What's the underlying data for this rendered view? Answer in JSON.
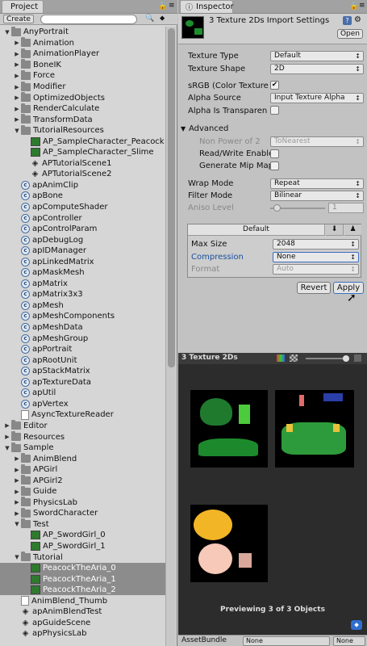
{
  "project": {
    "tab": "Project",
    "create_label": "Create",
    "tree": [
      {
        "label": "AnyPortrait",
        "depth": 0,
        "type": "folder",
        "open": true
      },
      {
        "label": "Animation",
        "depth": 1,
        "type": "folder",
        "arrow": true
      },
      {
        "label": "AnimationPlayer",
        "depth": 1,
        "type": "folder",
        "arrow": true
      },
      {
        "label": "BoneIK",
        "depth": 1,
        "type": "folder",
        "arrow": true
      },
      {
        "label": "Force",
        "depth": 1,
        "type": "folder",
        "arrow": true
      },
      {
        "label": "Modifier",
        "depth": 1,
        "type": "folder",
        "arrow": true
      },
      {
        "label": "OptimizedObjects",
        "depth": 1,
        "type": "folder",
        "arrow": true
      },
      {
        "label": "RenderCalculate",
        "depth": 1,
        "type": "folder",
        "arrow": true
      },
      {
        "label": "TransformData",
        "depth": 1,
        "type": "folder",
        "arrow": true
      },
      {
        "label": "TutorialResources",
        "depth": 1,
        "type": "folder",
        "open": true
      },
      {
        "label": "AP_SampleCharacter_Peacock",
        "depth": 2,
        "type": "img"
      },
      {
        "label": "AP_SampleCharacter_Slime",
        "depth": 2,
        "type": "img"
      },
      {
        "label": "APTutorialScene1",
        "depth": 2,
        "type": "unity"
      },
      {
        "label": "APTutorialScene2",
        "depth": 2,
        "type": "unity"
      },
      {
        "label": "apAnimClip",
        "depth": 1,
        "type": "cs"
      },
      {
        "label": "apBone",
        "depth": 1,
        "type": "cs"
      },
      {
        "label": "apComputeShader",
        "depth": 1,
        "type": "cs"
      },
      {
        "label": "apController",
        "depth": 1,
        "type": "cs"
      },
      {
        "label": "apControlParam",
        "depth": 1,
        "type": "cs"
      },
      {
        "label": "apDebugLog",
        "depth": 1,
        "type": "cs"
      },
      {
        "label": "apIDManager",
        "depth": 1,
        "type": "cs"
      },
      {
        "label": "apLinkedMatrix",
        "depth": 1,
        "type": "cs"
      },
      {
        "label": "apMaskMesh",
        "depth": 1,
        "type": "cs"
      },
      {
        "label": "apMatrix",
        "depth": 1,
        "type": "cs"
      },
      {
        "label": "apMatrix3x3",
        "depth": 1,
        "type": "cs"
      },
      {
        "label": "apMesh",
        "depth": 1,
        "type": "cs"
      },
      {
        "label": "apMeshComponents",
        "depth": 1,
        "type": "cs"
      },
      {
        "label": "apMeshData",
        "depth": 1,
        "type": "cs"
      },
      {
        "label": "apMeshGroup",
        "depth": 1,
        "type": "cs"
      },
      {
        "label": "apPortrait",
        "depth": 1,
        "type": "cs"
      },
      {
        "label": "apRootUnit",
        "depth": 1,
        "type": "cs"
      },
      {
        "label": "apStackMatrix",
        "depth": 1,
        "type": "cs"
      },
      {
        "label": "apTextureData",
        "depth": 1,
        "type": "cs"
      },
      {
        "label": "apUtil",
        "depth": 1,
        "type": "cs"
      },
      {
        "label": "apVertex",
        "depth": 1,
        "type": "cs"
      },
      {
        "label": "AsyncTextureReader",
        "depth": 1,
        "type": "doc"
      },
      {
        "label": "Editor",
        "depth": 0,
        "type": "folder",
        "arrow": true
      },
      {
        "label": "Resources",
        "depth": 0,
        "type": "folder",
        "arrow": true
      },
      {
        "label": "Sample",
        "depth": 0,
        "type": "folder",
        "open": true
      },
      {
        "label": "AnimBlend",
        "depth": 1,
        "type": "folder",
        "arrow": true
      },
      {
        "label": "APGirl",
        "depth": 1,
        "type": "folder",
        "arrow": true
      },
      {
        "label": "APGirl2",
        "depth": 1,
        "type": "folder",
        "arrow": true
      },
      {
        "label": "Guide",
        "depth": 1,
        "type": "folder",
        "arrow": true
      },
      {
        "label": "PhysicsLab",
        "depth": 1,
        "type": "folder",
        "arrow": true
      },
      {
        "label": "SwordCharacter",
        "depth": 1,
        "type": "folder",
        "arrow": true
      },
      {
        "label": "Test",
        "depth": 1,
        "type": "folder",
        "open": true
      },
      {
        "label": "AP_SwordGirl_0",
        "depth": 2,
        "type": "img"
      },
      {
        "label": "AP_SwordGirl_1",
        "depth": 2,
        "type": "img"
      },
      {
        "label": "Tutorial",
        "depth": 1,
        "type": "folder",
        "open": true
      },
      {
        "label": "PeacockTheAria_0",
        "depth": 2,
        "type": "img",
        "sel": true
      },
      {
        "label": "PeacockTheAria_1",
        "depth": 2,
        "type": "img",
        "sel": true
      },
      {
        "label": "PeacockTheAria_2",
        "depth": 2,
        "type": "img",
        "sel": true
      },
      {
        "label": "AnimBlend_Thumb",
        "depth": 1,
        "type": "doc"
      },
      {
        "label": "apAnimBlendTest",
        "depth": 1,
        "type": "unity"
      },
      {
        "label": "apGuideScene",
        "depth": 1,
        "type": "unity"
      },
      {
        "label": "apPhysicsLab",
        "depth": 1,
        "type": "unity"
      }
    ]
  },
  "inspector": {
    "tab": "Inspector",
    "title": "3 Texture 2Ds Import Settings",
    "open_label": "Open",
    "texture_type_label": "Texture Type",
    "texture_type_value": "Default",
    "texture_shape_label": "Texture Shape",
    "texture_shape_value": "2D",
    "srgb_label": "sRGB (Color Texture",
    "alpha_source_label": "Alpha Source",
    "alpha_source_value": "Input Texture Alpha",
    "alpha_transparency_label": "Alpha Is Transparen",
    "advanced_label": "Advanced",
    "npot_label": "Non Power of 2",
    "npot_value": "ToNearest",
    "readwrite_label": "Read/Write Enable",
    "mipmaps_label": "Generate Mip Map",
    "wrap_label": "Wrap Mode",
    "wrap_value": "Repeat",
    "filter_label": "Filter Mode",
    "filter_value": "Bilinear",
    "aniso_label": "Aniso Level",
    "aniso_value": "1",
    "platform_label": "Default",
    "maxsize_label": "Max Size",
    "maxsize_value": "2048",
    "compression_label": "Compression",
    "compression_value": "None",
    "format_label": "Format",
    "format_value": "Auto",
    "revert_label": "Revert",
    "apply_label": "Apply"
  },
  "preview": {
    "title": "3 Texture 2Ds",
    "caption": "Previewing 3 of 3 Objects"
  },
  "bottom": {
    "label": "AssetBundle",
    "value1": "None",
    "value2": "None"
  }
}
